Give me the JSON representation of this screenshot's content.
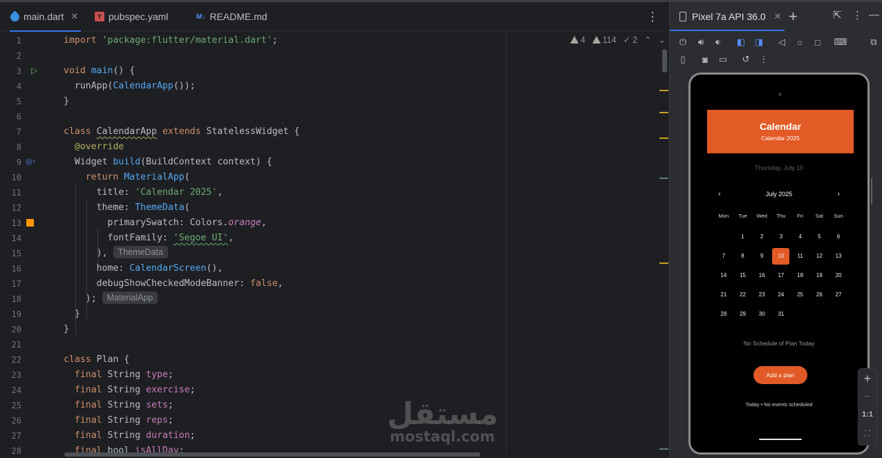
{
  "editor": {
    "tabs": [
      {
        "label": "main.dart",
        "active": true
      },
      {
        "label": "pubspec.yaml",
        "active": false
      },
      {
        "label": "README.md",
        "active": false
      }
    ],
    "inspections": {
      "warnings": "4",
      "weak_warnings": "114",
      "typos": "2"
    },
    "line_numbers": [
      "1",
      "2",
      "3",
      "4",
      "5",
      "6",
      "7",
      "8",
      "9",
      "10",
      "11",
      "12",
      "13",
      "14",
      "15",
      "16",
      "17",
      "18",
      "19",
      "20",
      "21",
      "22",
      "23",
      "24",
      "25",
      "26",
      "27",
      "28"
    ],
    "code": {
      "l1_import": "import",
      "l1_str": "'package:flutter/material.dart'",
      "l1_end": ";",
      "l3_void": "void",
      "l3_main": "main",
      "l3_rest": "() {",
      "l4_pre": "  runApp(",
      "l4_cls": "CalendarApp",
      "l4_end": "());",
      "l5": "}",
      "l7_class": "class",
      "l7_name": "CalendarApp",
      "l7_extends": "extends",
      "l7_rest": "StatelessWidget {",
      "l8_ann": "@override",
      "l9_pre": "  Widget ",
      "l9_fn": "build",
      "l9_rest": "(BuildContext context) {",
      "l10_ret": "return",
      "l10_cls": "MaterialApp",
      "l10_rest": "(",
      "l11_pre": "      title: ",
      "l11_str": "'Calendar 2025'",
      "l11_end": ",",
      "l12_pre": "      theme: ",
      "l12_cls": "ThemeData",
      "l12_end": "(",
      "l13_pre": "        primarySwatch: Colors.",
      "l13_it": "orange",
      "l13_end": ",",
      "l14_pre": "        fontFamily: ",
      "l14_str": "'Segoe UI'",
      "l14_end": ",",
      "l15_pre": "      ),",
      "l15_hint": "ThemeData",
      "l16_pre": "      home: ",
      "l16_cls": "CalendarScreen",
      "l16_end": "(),",
      "l17_pre": "      debugShowCheckedModeBanner: ",
      "l17_kw": "false",
      "l17_end": ",",
      "l18_pre": "    );",
      "l18_hint": "MaterialApp",
      "l19": "  }",
      "l20": "}",
      "l22_class": "class",
      "l22_rest": " Plan {",
      "fields": [
        {
          "kw": "final",
          "type": " String ",
          "name": "type"
        },
        {
          "kw": "final",
          "type": " String ",
          "name": "exercise"
        },
        {
          "kw": "final",
          "type": " String ",
          "name": "sets"
        },
        {
          "kw": "final",
          "type": " String ",
          "name": "reps"
        },
        {
          "kw": "final",
          "type": " String ",
          "name": "duration"
        },
        {
          "kw": "final",
          "type": " bool ",
          "name": "isAllDay"
        }
      ],
      "semi": ";"
    }
  },
  "devices": {
    "tab_label": "Pixel 7a API 36.0",
    "app": {
      "appbar_title": "Calendar",
      "appbar_subtitle": "Calendar 2025",
      "selected_date_text": "Thursday, July 10",
      "month_label": "July 2025",
      "prev": "‹",
      "next": "›",
      "weekdays": [
        "Mon",
        "Tue",
        "Wed",
        "Thu",
        "Fri",
        "Sat",
        "Sun"
      ],
      "days": [
        "1",
        "2",
        "3",
        "4",
        "5",
        "6",
        "7",
        "8",
        "9",
        "10",
        "11",
        "12",
        "13",
        "14",
        "15",
        "16",
        "17",
        "18",
        "19",
        "20",
        "21",
        "22",
        "23",
        "24",
        "25",
        "26",
        "27",
        "28",
        "29",
        "30",
        "31"
      ],
      "selected_day": "10",
      "no_plan_text": "No Schedule of Plan Today",
      "add_button": "Add a plan",
      "today_text": "Today • No events scheduled"
    },
    "zoom": {
      "plus": "+",
      "minus": "−",
      "ratio": "1:1"
    }
  },
  "watermark": {
    "arabic": "مستقل",
    "latin": "mostaql.com"
  },
  "colors": {
    "accent": "#e25a25",
    "tab_underline": "#3574f0"
  }
}
